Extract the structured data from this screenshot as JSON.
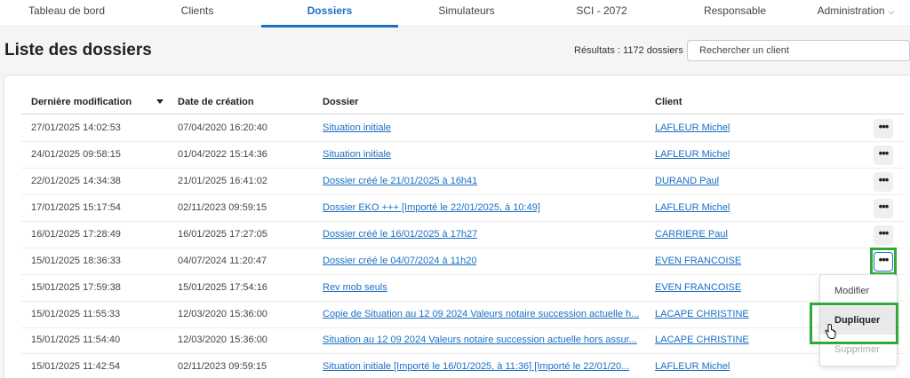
{
  "nav": {
    "items": [
      {
        "label": "Tableau de bord"
      },
      {
        "label": "Clients"
      },
      {
        "label": "Dossiers"
      },
      {
        "label": "Simulateurs"
      },
      {
        "label": "SCI - 2072"
      },
      {
        "label": "Responsable"
      },
      {
        "label": "Administration"
      }
    ],
    "active_index": 2
  },
  "page": {
    "title": "Liste des dossiers",
    "results": "Résultats : 1172 dossiers",
    "search_placeholder": "Rechercher un client"
  },
  "table": {
    "headers": {
      "modified": "Dernière modification",
      "created": "Date de création",
      "dossier": "Dossier",
      "client": "Client"
    },
    "rows": [
      {
        "modified": "27/01/2025 14:02:53",
        "created": "07/04/2020 16:20:40",
        "dossier": "Situation initiale",
        "client": "LAFLEUR Michel"
      },
      {
        "modified": "24/01/2025 09:58:15",
        "created": "01/04/2022 15:14:36",
        "dossier": "Situation initiale",
        "client": "LAFLEUR Michel"
      },
      {
        "modified": "22/01/2025 14:34:38",
        "created": "21/01/2025 16:41:02",
        "dossier": "Dossier créé le 21/01/2025 à 16h41",
        "client": "DURAND Paul"
      },
      {
        "modified": "17/01/2025 15:17:54",
        "created": "02/11/2023 09:59:15",
        "dossier": "Dossier EKO +++ [Importé le 22/01/2025, à 10:49]",
        "client": "LAFLEUR Michel"
      },
      {
        "modified": "16/01/2025 17:28:49",
        "created": "16/01/2025 17:27:05",
        "dossier": "Dossier créé le 16/01/2025 à 17h27",
        "client": "CARRIERE Paul"
      },
      {
        "modified": "15/01/2025 18:36:33",
        "created": "04/07/2024 11:20:47",
        "dossier": "Dossier créé le 04/07/2024 à 11h20",
        "client": "EVEN FRANCOISE"
      },
      {
        "modified": "15/01/2025 17:59:38",
        "created": "15/01/2025 17:54:16",
        "dossier": "Rev mob seuls",
        "client": "EVEN FRANCOISE"
      },
      {
        "modified": "15/01/2025 11:55:33",
        "created": "12/03/2020 15:36:00",
        "dossier": "Copie de Situation au 12 09 2024 Valeurs notaire succession actuelle h...",
        "client": "LACAPE CHRISTINE"
      },
      {
        "modified": "15/01/2025 11:54:40",
        "created": "12/03/2020 15:36:00",
        "dossier": "Situation au 12 09 2024 Valeurs notaire succession actuelle hors assur...",
        "client": "LACAPE CHRISTINE"
      },
      {
        "modified": "15/01/2025 11:42:54",
        "created": "02/11/2023 09:59:15",
        "dossier": "Situation initiale [Importé le 16/01/2025, à 11:36] [Importé le 22/01/20...",
        "client": "LAFLEUR Michel"
      }
    ],
    "more_label": "•••"
  },
  "menu": {
    "items": [
      {
        "label": "Modifier"
      },
      {
        "label": "Dupliquer"
      },
      {
        "label": "Supprimer"
      }
    ]
  },
  "colors": {
    "accent": "#1a6fc4",
    "highlight": "#2eaa3c"
  }
}
